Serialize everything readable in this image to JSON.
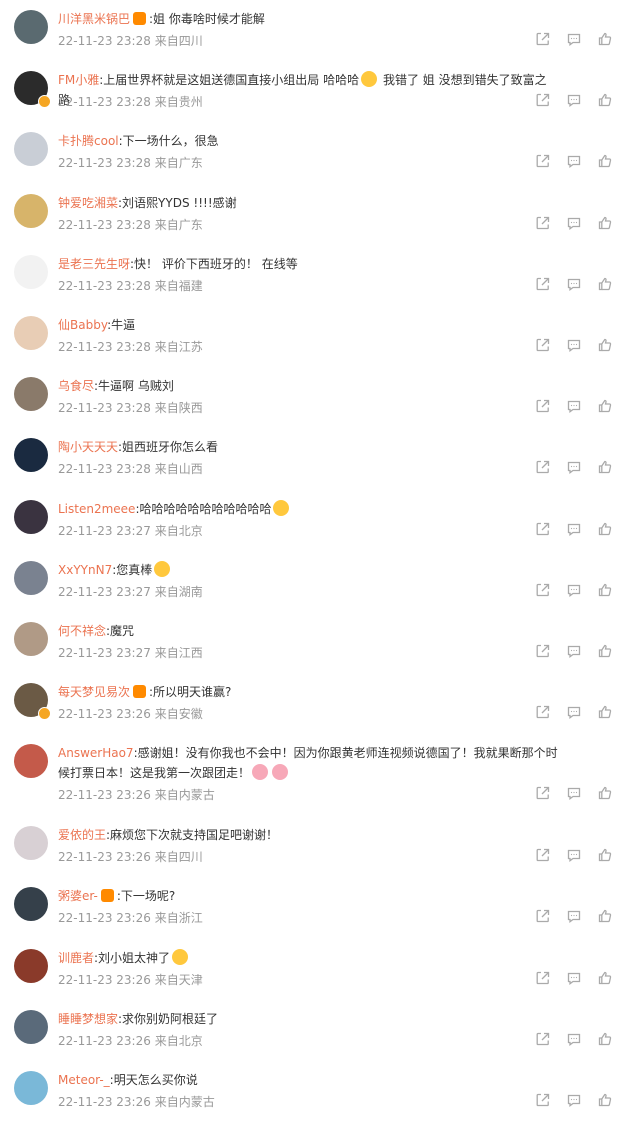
{
  "comments": [
    {
      "user": "川洋黑米锅巴",
      "badge": true,
      "text": ":姐 你毒啥时候才能解",
      "time": "22-11-23 23:28",
      "location": "来自四川",
      "avatar_color": "#5a6a70"
    },
    {
      "user": "FM小雅",
      "verified": true,
      "text": ":上届世界杯就是这姐送德国直接小组出局 哈哈哈",
      "emoji": true,
      "text2": " 我错了 姐 没想到错失了致富之路",
      "time": "22-11-23 23:28",
      "location": "来自贵州",
      "avatar_color": "#2b2b2b"
    },
    {
      "user": "卡扑腾cool",
      "text": ":下一场什么，很急",
      "time": "22-11-23 23:28",
      "location": "来自广东",
      "avatar_color": "#c9ced6"
    },
    {
      "user": "钟爱吃湘菜",
      "text": ":刘语熙YYDS !!!!感谢",
      "time": "22-11-23 23:28",
      "location": "来自广东",
      "avatar_color": "#d7b46a"
    },
    {
      "user": "是老三先生呀",
      "text": ":快！ 评价下西班牙的！ 在线等",
      "time": "22-11-23 23:28",
      "location": "来自福建",
      "avatar_color": "#f2f2f2"
    },
    {
      "user": "仙Babby",
      "text": ":牛逼",
      "time": "22-11-23 23:28",
      "location": "来自江苏",
      "avatar_color": "#e8cdb5"
    },
    {
      "user": "乌食尽",
      "text": ":牛逼啊 乌贼刘",
      "time": "22-11-23 23:28",
      "location": "来自陕西",
      "avatar_color": "#8a7a6a"
    },
    {
      "user": "陶小天天天",
      "text": ":姐西班牙你怎么看",
      "time": "22-11-23 23:28",
      "location": "来自山西",
      "avatar_color": "#1a2a40"
    },
    {
      "user": "Listen2meee",
      "text": ":哈哈哈哈哈哈哈哈哈哈哈",
      "emoji": true,
      "time": "22-11-23 23:27",
      "location": "来自北京",
      "avatar_color": "#3a3340"
    },
    {
      "user": "XxYYnN7",
      "text": ":您真棒",
      "emoji": true,
      "time": "22-11-23 23:27",
      "location": "来自湖南",
      "avatar_color": "#7a8290"
    },
    {
      "user": "何不祥念",
      "text": ":魔咒",
      "time": "22-11-23 23:27",
      "location": "来自江西",
      "avatar_color": "#b09a86"
    },
    {
      "user": "每天梦见易次",
      "badge": true,
      "verified": true,
      "text": ":所以明天谁赢?",
      "time": "22-11-23 23:26",
      "location": "来自安徽",
      "avatar_color": "#6b5a45"
    },
    {
      "user": "AnswerHao7",
      "text": ":感谢姐！没有你我也不会中！因为你跟黄老师连视频说德国了！我就果断那个时候打票日本！这是我第一次跟团走！",
      "emoji2": true,
      "time": "22-11-23 23:26",
      "location": "来自内蒙古",
      "avatar_color": "#c45a4a",
      "tall": true
    },
    {
      "user": "爱依的王",
      "text": ":麻烦您下次就支持国足吧谢谢！",
      "time": "22-11-23 23:26",
      "location": "来自四川",
      "avatar_color": "#d8d0d4"
    },
    {
      "user": "粥婆er-",
      "badge": true,
      "text": ":下一场呢?",
      "time": "22-11-23 23:26",
      "location": "来自浙江",
      "avatar_color": "#35404a"
    },
    {
      "user": "训鹿者",
      "text": ":刘小姐太神了",
      "emoji": true,
      "time": "22-11-23 23:26",
      "location": "来自天津",
      "avatar_color": "#8a3a2a"
    },
    {
      "user": "睡睡梦想家",
      "text": ":求你别奶阿根廷了",
      "time": "22-11-23 23:26",
      "location": "来自北京",
      "avatar_color": "#5a6a7a"
    },
    {
      "user": "Meteor-_",
      "text": ":明天怎么买你说",
      "time": "22-11-23 23:26",
      "location": "来自内蒙古",
      "avatar_color": "#7ab8d8"
    }
  ],
  "icons": {
    "share": "share-icon",
    "comment": "comment-icon",
    "like": "like-icon"
  }
}
